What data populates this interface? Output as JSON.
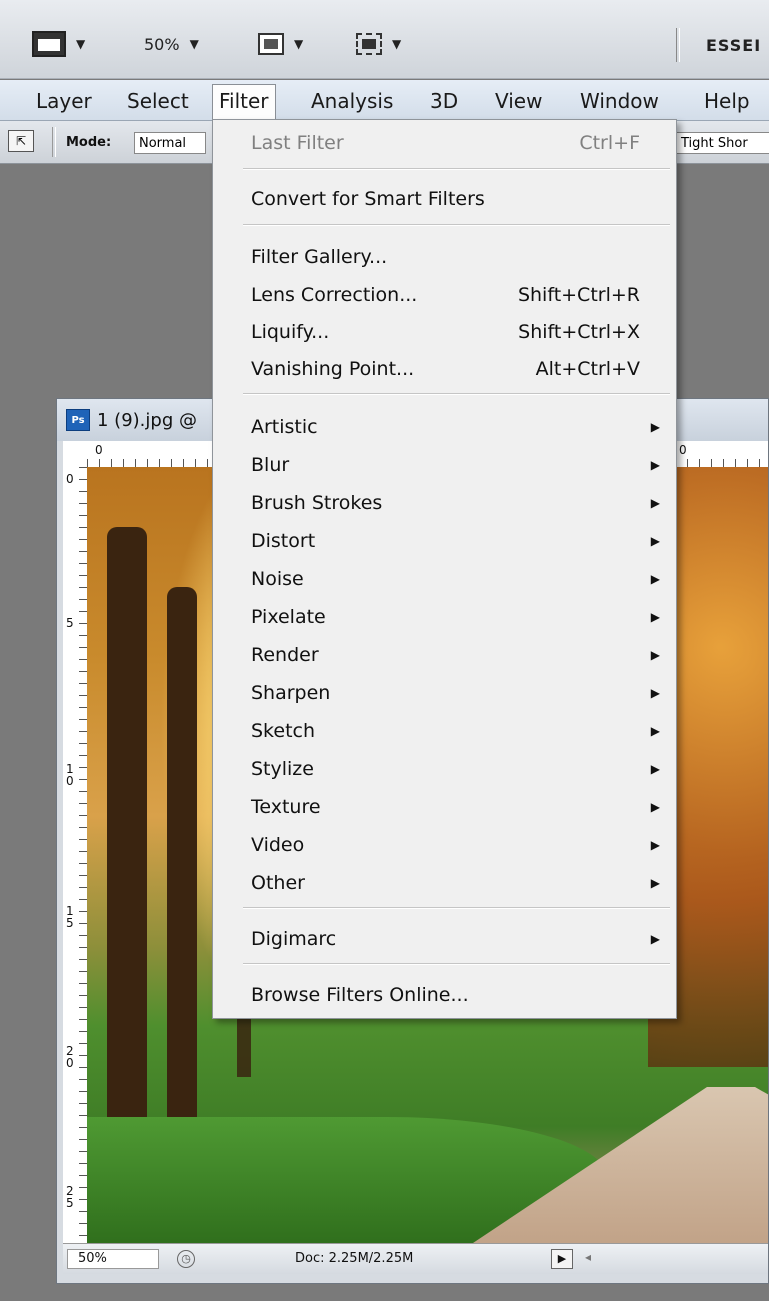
{
  "toolbar": {
    "zoom": "50%",
    "workspace": "ESSEI"
  },
  "menubar": {
    "items": [
      "Layer",
      "Select",
      "Filter",
      "Analysis",
      "3D",
      "View",
      "Window",
      "Help"
    ]
  },
  "options_bar": {
    "mode_label": "Mode:",
    "mode_value": "Normal",
    "right_value": "Tight Shor"
  },
  "document": {
    "badge": "Ps",
    "title": "1 (9).jpg @",
    "ruler_top": [
      "0",
      "0"
    ],
    "ruler_left": [
      "0",
      "5",
      "1\n0",
      "1\n5",
      "2\n0",
      "2\n5"
    ],
    "zoom": "50%",
    "doc_info": "Doc: 2.25M/2.25M"
  },
  "filter_menu": {
    "last_filter": "Last Filter",
    "last_filter_shortcut": "Ctrl+F",
    "convert": "Convert for Smart Filters",
    "gallery": "Filter Gallery...",
    "lens": "Lens Correction...",
    "lens_shortcut": "Shift+Ctrl+R",
    "liquify": "Liquify...",
    "liquify_shortcut": "Shift+Ctrl+X",
    "vanishing": "Vanishing Point...",
    "vanishing_shortcut": "Alt+Ctrl+V",
    "submenus": [
      "Artistic",
      "Blur",
      "Brush Strokes",
      "Distort",
      "Noise",
      "Pixelate",
      "Render",
      "Sharpen",
      "Sketch",
      "Stylize",
      "Texture",
      "Video",
      "Other"
    ],
    "digimarc": "Digimarc",
    "browse": "Browse Filters Online..."
  }
}
